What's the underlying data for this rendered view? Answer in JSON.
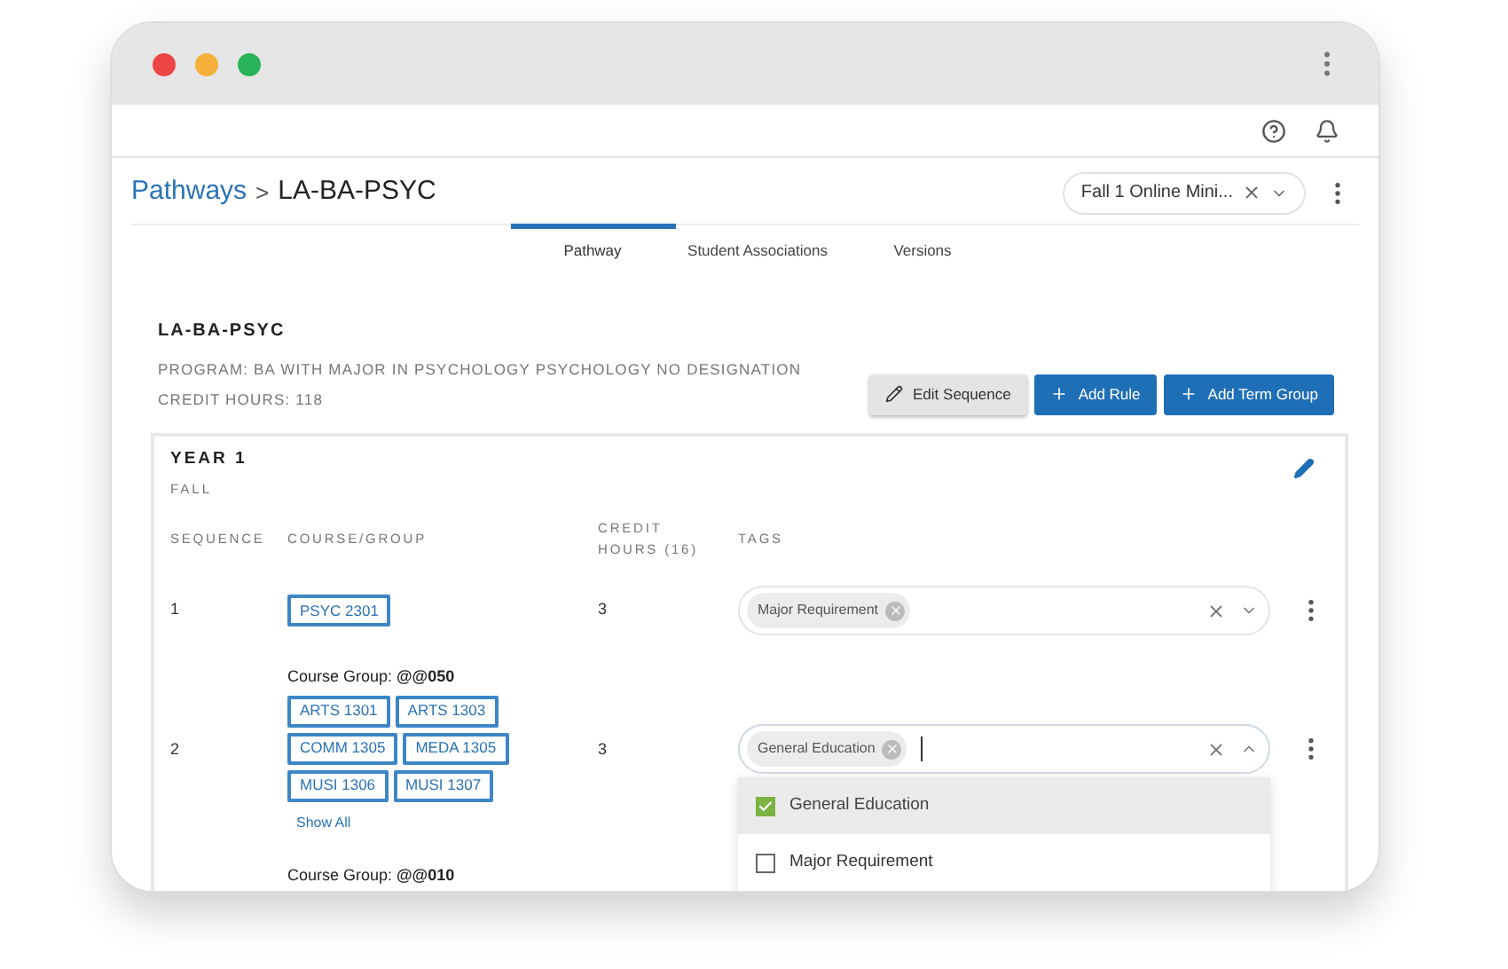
{
  "breadcrumb": {
    "root": "Pathways",
    "separator": ">",
    "current": "LA-BA-PSYC"
  },
  "term_select": {
    "value": "Fall 1 Online Mini..."
  },
  "tabs": [
    {
      "label": "Pathway",
      "selected": true
    },
    {
      "label": "Student Associations",
      "selected": false
    },
    {
      "label": "Versions",
      "selected": false
    }
  ],
  "program": {
    "code": "LA-BA-PSYC",
    "description": "PROGRAM: BA WITH MAJOR IN PSYCHOLOGY PSYCHOLOGY NO DESIGNATION",
    "credit_hours": "CREDIT HOURS: 118"
  },
  "actions": [
    {
      "label": "Edit Sequence",
      "kind": "edit"
    },
    {
      "label": "Add Rule",
      "kind": "add"
    },
    {
      "label": "Add Term Group",
      "kind": "add"
    }
  ],
  "year": {
    "title": "YEAR 1",
    "term": "FALL"
  },
  "columns": [
    "SEQUENCE",
    "COURSE/GROUP",
    "CREDIT HOURS (16)",
    "TAGS"
  ],
  "rows": [
    {
      "sequence": "1",
      "courses": [
        "PSYC 2301"
      ],
      "credits": "3",
      "tags": {
        "chips": [
          "Major Requirement"
        ],
        "expanded": false
      }
    },
    {
      "sequence": "2",
      "group": {
        "label": "Course Group: ",
        "code": "@@050"
      },
      "courses": [
        "ARTS 1301",
        "ARTS 1303",
        "COMM 1305",
        "MEDA 1305",
        "MUSI 1306",
        "MUSI 1307"
      ],
      "show_all": "Show All",
      "credits": "3",
      "tags": {
        "chips": [
          "General Education"
        ],
        "expanded": true,
        "options": [
          {
            "label": "General Education",
            "checked": true
          },
          {
            "label": "Major Requirement",
            "checked": false
          }
        ]
      }
    },
    {
      "group": {
        "label": "Course Group: ",
        "code": "@@010"
      }
    }
  ]
}
